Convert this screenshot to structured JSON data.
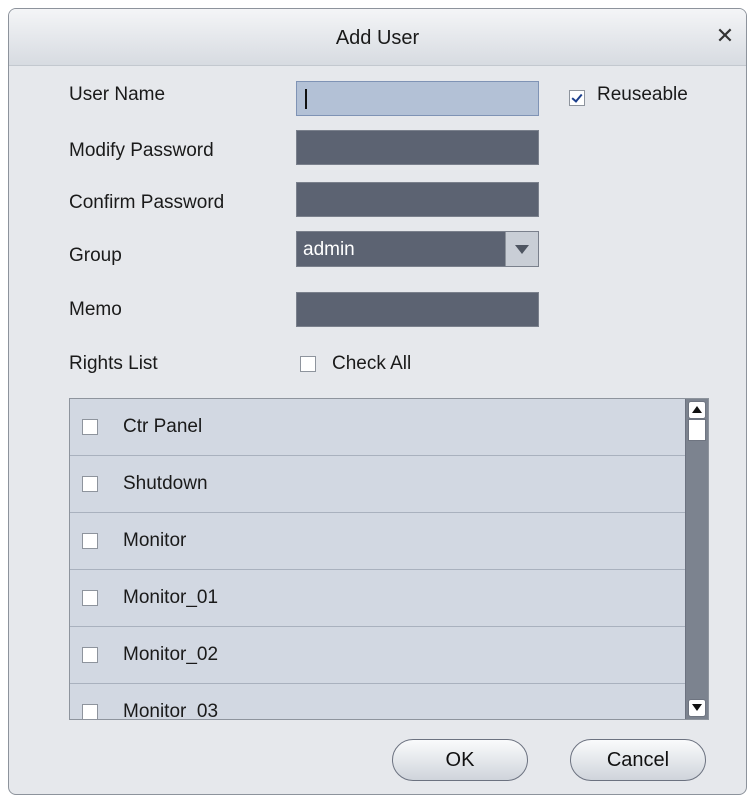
{
  "dialog": {
    "title": "Add User"
  },
  "form": {
    "user_name_label": "User Name",
    "user_name_value": "",
    "reuseable_label": "Reuseable",
    "reuseable_checked": true,
    "modify_password_label": "Modify Password",
    "confirm_password_label": "Confirm Password",
    "group_label": "Group",
    "group_value": "admin",
    "memo_label": "Memo",
    "rights_list_label": "Rights List",
    "check_all_label": "Check All"
  },
  "rights": [
    {
      "label": "Ctr Panel",
      "checked": false
    },
    {
      "label": "Shutdown",
      "checked": false
    },
    {
      "label": "Monitor",
      "checked": false
    },
    {
      "label": "Monitor_01",
      "checked": false
    },
    {
      "label": "Monitor_02",
      "checked": false
    },
    {
      "label": "Monitor_03",
      "checked": false
    }
  ],
  "buttons": {
    "ok": "OK",
    "cancel": "Cancel"
  },
  "icons": {
    "close": "close-icon",
    "dropdown": "chevron-down-icon",
    "scroll_up": "arrow-up-icon",
    "scroll_down": "arrow-down-icon"
  }
}
